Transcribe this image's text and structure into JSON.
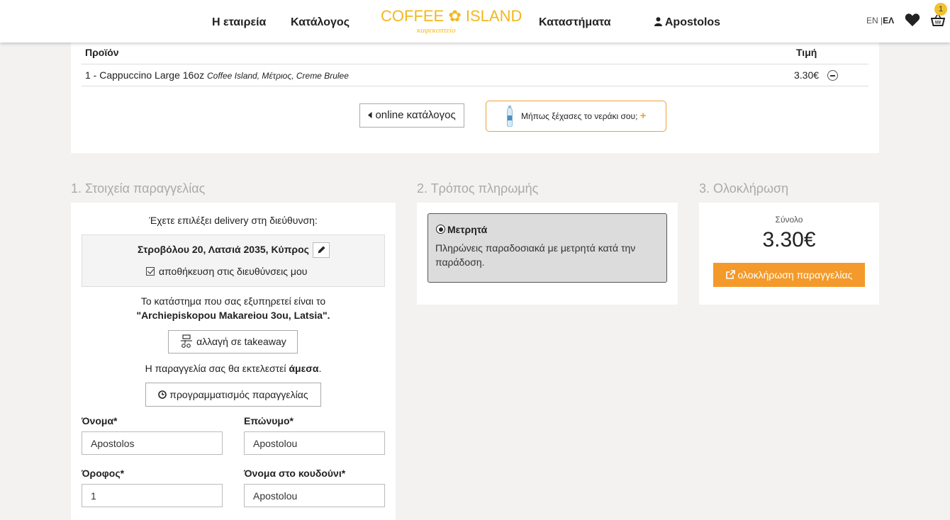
{
  "header": {
    "nav": {
      "company": "Η εταιρεία",
      "catalog": "Κατάλογος",
      "stores": "Καταστήματα",
      "user": "Apostolos"
    },
    "logo": {
      "main": "COFFEE ✿ ISLAND",
      "sub": "καφεκοπτείο"
    },
    "lang": {
      "en": "EN",
      "sep": "|",
      "el": "ΕΛ"
    },
    "cart_count": "1",
    "icons": [
      "user-icon",
      "heart-icon",
      "basket-icon"
    ]
  },
  "summary": {
    "col_product": "Προϊόν",
    "col_price": "Τιμή",
    "item": {
      "name": "1 - Cappuccino Large 16oz",
      "details": "Coffee Island, Μέτριος, Creme Brulee",
      "price": "3.30€"
    },
    "btn_catalog": "online κατάλογος",
    "btn_water": "Μήπως ξέχασες το νεράκι σου;"
  },
  "sections": {
    "s1": "1. Στοιχεία παραγγελίας",
    "s2": "2. Τρόπος πληρωμής",
    "s3": "3. Ολοκλήρωση"
  },
  "details": {
    "delivery_intro": "Έχετε επιλέξει delivery στη διεύθυνση:",
    "address": "Στροβόλου 20, Λατσιά 2035, Κύπρος",
    "save_address": "αποθήκευση στις διευθύνσεις μου",
    "store_line1": "Το κατάστημα που σας εξυπηρετεί είναι το",
    "store_name": "\"Archiepiskopou Makareiou 3ou, Latsia\".",
    "btn_takeaway": "αλλαγή σε takeaway",
    "exec_prefix": "Η παραγγελία σας θα εκτελεστεί ",
    "exec_bold": "άμεσα",
    "exec_suffix": ".",
    "btn_schedule": "προγραμματισμός παραγγελίας",
    "fields": {
      "first_name": {
        "label": "Όνομα*",
        "value": "Apostolos"
      },
      "last_name": {
        "label": "Επώνυμο*",
        "value": "Apostolou"
      },
      "floor": {
        "label": "Όροφος*",
        "value": "1"
      },
      "doorbell": {
        "label": "Όνομα στο κουδούνι*",
        "value": "Apostolou"
      }
    }
  },
  "payment": {
    "option_title": "Μετρητά",
    "option_desc": "Πληρώνεις παραδοσιακά με μετρητά κατά την παράδοση."
  },
  "complete": {
    "total_label": "Σύνολο",
    "total_value": "3.30€",
    "btn_complete": "ολοκλήρωση παραγγελίας"
  },
  "colors": {
    "accent": "#f39a2a",
    "logo": "#f2b81e",
    "badge": "#f2c12e"
  }
}
